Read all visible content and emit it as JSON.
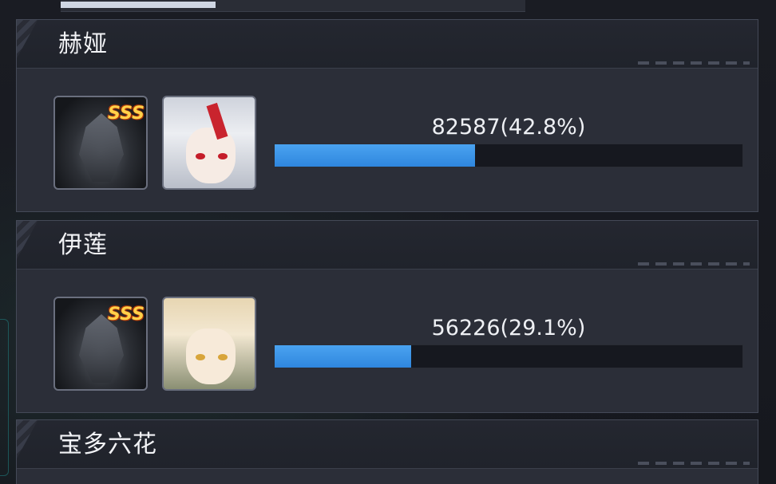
{
  "cards": [
    {
      "name": "赫娅",
      "badge": "SSS",
      "stat": "82587(42.8%)",
      "ratio": 0.428
    },
    {
      "name": "伊莲",
      "badge": "SSS",
      "stat": "56226(29.1%)",
      "ratio": 0.291
    },
    {
      "name": "宝多六花"
    }
  ]
}
